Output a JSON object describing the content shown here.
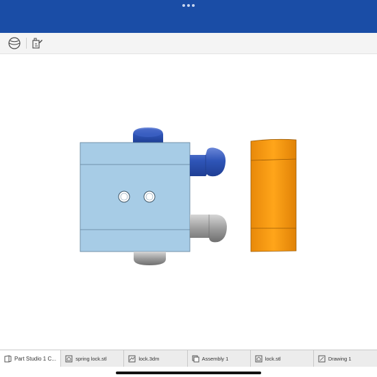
{
  "app": {
    "accent_color": "#1a4da6",
    "more_icon": "ellipsis-icon"
  },
  "toolbar": {
    "items": [
      {
        "name": "view-cube-icon",
        "interactable": true
      },
      {
        "name": "configure-tool-icon",
        "interactable": true
      }
    ]
  },
  "viewport": {
    "model_parts": [
      {
        "name": "lock-body",
        "color": "#a7cce6"
      },
      {
        "name": "blue-pin-top",
        "color": "#2f55b8"
      },
      {
        "name": "blue-pin-right",
        "color": "#2f55b8"
      },
      {
        "name": "gray-pin-right",
        "color": "#9d9d9d"
      },
      {
        "name": "gray-pin-bottom",
        "color": "#9d9d9d"
      },
      {
        "name": "orange-ring",
        "color": "#ff9f10"
      }
    ]
  },
  "tabs": [
    {
      "label": "Part Studio 1 C...",
      "icon": "part-studio-icon"
    },
    {
      "label": "spring lock.stl",
      "icon": "stl-file-icon"
    },
    {
      "label": "lock.3dm",
      "icon": "3dm-file-icon"
    },
    {
      "label": "Assembly 1",
      "icon": "assembly-icon"
    },
    {
      "label": "lock.stl",
      "icon": "stl-file-icon"
    },
    {
      "label": "Drawing 1",
      "icon": "drawing-icon"
    }
  ]
}
